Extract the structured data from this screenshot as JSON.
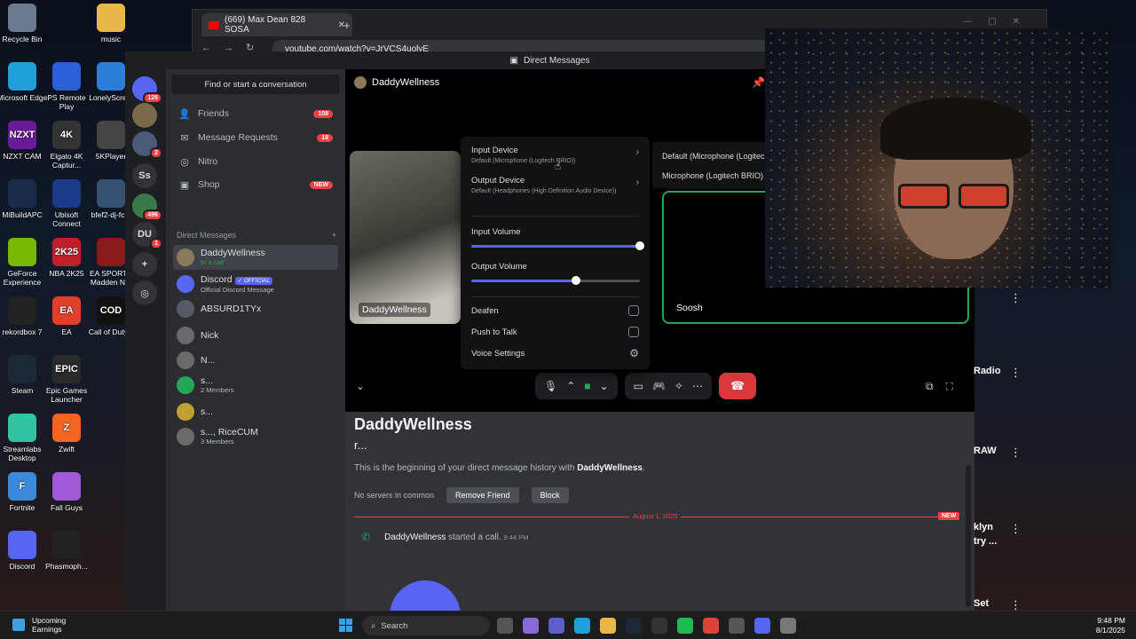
{
  "desktop_icons": [
    {
      "label": "Recycle Bin",
      "icon": "recycle-bin-icon",
      "color": "#6b7a8f"
    },
    {
      "label": "music",
      "icon": "folder-icon",
      "color": "#e8b84a"
    },
    {
      "label": "Microsoft Edge",
      "icon": "edge-icon",
      "color": "#1fa0d8"
    },
    {
      "label": "PS Remote Play",
      "icon": "ps-remote-play-icon",
      "color": "#2b5fd9"
    },
    {
      "label": "LonelyScre...",
      "icon": "monitor-icon",
      "color": "#2b7fd9"
    },
    {
      "label": "NZXT CAM",
      "icon": "nzxt-cam-icon",
      "color": "#6a1b9a",
      "glyph": "NZXT"
    },
    {
      "label": "Elgato 4K Captur...",
      "icon": "elgato-4k-icon",
      "color": "#333333",
      "glyph": "4K"
    },
    {
      "label": "5KPlayer",
      "icon": "5kplayer-icon",
      "color": "#444444"
    },
    {
      "label": "MiBuildAPC",
      "icon": "mibuildapc-icon",
      "color": "#1a2a4a"
    },
    {
      "label": "Ubisoft Connect",
      "icon": "ubisoft-icon",
      "color": "#1a3a8a"
    },
    {
      "label": "bfef2-dj-fc...",
      "icon": "image-file-icon",
      "color": "#355070"
    },
    {
      "label": "GeForce Experience",
      "icon": "geforce-icon",
      "color": "#76b900"
    },
    {
      "label": "NBA 2K25",
      "icon": "nba2k25-icon",
      "color": "#c0202a",
      "glyph": "2K25"
    },
    {
      "label": "EA SPORTS Madden N...",
      "icon": "madden-icon",
      "color": "#8a1a1a"
    },
    {
      "label": "rekordbox 7",
      "icon": "rekordbox-icon",
      "color": "#222222"
    },
    {
      "label": "EA",
      "icon": "ea-icon",
      "color": "#e0402a",
      "glyph": "EA"
    },
    {
      "label": "Call of Duty®",
      "icon": "call-of-duty-icon",
      "color": "#111111",
      "glyph": "COD"
    },
    {
      "label": "Steam",
      "icon": "steam-icon",
      "color": "#1b2838"
    },
    {
      "label": "Epic Games Launcher",
      "icon": "epic-games-icon",
      "color": "#2a2a2a",
      "glyph": "EPIC"
    },
    {
      "label": "Streamlabs Desktop",
      "icon": "streamlabs-icon",
      "color": "#31c3a2"
    },
    {
      "label": "Zwift",
      "icon": "zwift-icon",
      "color": "#f26522",
      "glyph": "Z"
    },
    {
      "label": "Fortnite",
      "icon": "fortnite-icon",
      "color": "#3a8ad9",
      "glyph": "F"
    },
    {
      "label": "Fall Guys",
      "icon": "fall-guys-icon",
      "color": "#a05ad9"
    },
    {
      "label": "Discord",
      "icon": "discord-icon",
      "color": "#5865f2"
    },
    {
      "label": "Phasmoph...",
      "icon": "phasmophobia-icon",
      "color": "#222222"
    }
  ],
  "browser": {
    "tab_title": "(669) Max Dean 828 SOSA",
    "url": "youtube.com/watch?v=JrVCS4uolyE"
  },
  "discord": {
    "window_title": "Direct Messages",
    "servers": [
      {
        "label": "",
        "badge": "126",
        "icon": "discord-home-icon",
        "color": "#5865f2"
      },
      {
        "label": "",
        "badge": "",
        "icon": "server-avatar-icon",
        "color": "#7a6a4a"
      },
      {
        "label": "",
        "badge": "2",
        "icon": "server-avatar-icon",
        "color": "#4a5a7a"
      },
      {
        "label": "Ss",
        "badge": "",
        "icon": "",
        "color": "#313338"
      },
      {
        "label": "",
        "badge": "496",
        "icon": "server-avatar-icon",
        "color": "#3a7a4a"
      },
      {
        "label": "DU",
        "badge": "1",
        "icon": "",
        "color": "#313338"
      },
      {
        "label": "+",
        "badge": "",
        "icon": "add-server-icon",
        "color": "#313338"
      },
      {
        "label": "◎",
        "badge": "",
        "icon": "discover-icon",
        "color": "#313338"
      }
    ],
    "search_placeholder": "Find or start a conversation",
    "nav": [
      {
        "label": "Friends",
        "badge": "108",
        "icon": "friends-icon",
        "glyph": "👤"
      },
      {
        "label": "Message Requests",
        "badge": "18",
        "icon": "message-requests-icon",
        "glyph": "✉"
      },
      {
        "label": "Nitro",
        "badge": "",
        "icon": "nitro-icon",
        "glyph": "◎"
      },
      {
        "label": "Shop",
        "badge": "NEW",
        "icon": "shop-icon",
        "glyph": "▣"
      }
    ],
    "dm_header": "Direct Messages",
    "dms": [
      {
        "name": "DaddyWellness",
        "sub": "In a call",
        "color": "#8a7a5a"
      },
      {
        "name": "Discord",
        "sub": "Official Discord Message",
        "tag": "✓ OFFICIAL",
        "color": "#5865f2"
      },
      {
        "name": "ABSURD1TYx",
        "sub": "",
        "color": "#555a66"
      },
      {
        "name": "Nick",
        "sub": "",
        "color": "#6a6a6a"
      },
      {
        "name": "N...",
        "sub": "",
        "color": "#6a6a6a"
      },
      {
        "name": "s...",
        "sub": "2 Members",
        "color": "#23a55a"
      },
      {
        "name": "s...",
        "sub": "",
        "color": "#c0a030"
      },
      {
        "name": "s..., RiceCUM",
        "sub": "3 Members",
        "color": "#6a6a6a"
      }
    ],
    "call": {
      "header_name": "DaddyWellness",
      "tiles": [
        {
          "label": "DaddyWellness"
        },
        {
          "label": "Soosh"
        }
      ]
    },
    "audio_popup": {
      "input_device_title": "Input Device",
      "input_device_value": "Default (Microphone (Logitech BRIO))",
      "output_device_title": "Output Device",
      "output_device_value": "Default (Headphones (High Definition Audio Device))",
      "input_volume_label": "Input Volume",
      "input_volume": 1.0,
      "output_volume_label": "Output Volume",
      "output_volume": 0.62,
      "deafen_label": "Deafen",
      "push_to_talk_label": "Push to Talk",
      "voice_settings_label": "Voice Settings"
    },
    "input_submenu": [
      "Default (Microphone (Logitech BRIO))",
      "Microphone (Logitech BRIO)"
    ],
    "chat": {
      "title": "DaddyWellness",
      "handle": "r...",
      "beginning_prefix": "This is the beginning of your direct message history with ",
      "beginning_name": "DaddyWellness",
      "beginning_suffix": ".",
      "no_servers": "No servers in common",
      "remove_friend": "Remove Friend",
      "block": "Block",
      "date_divider": "August 1, 2025",
      "new_tag": "NEW",
      "call_author": "DaddyWellness",
      "call_text": "started a call.",
      "call_time": "9:44 PM"
    }
  },
  "youtube_peek": [
    "Radio",
    "RAW",
    "klyn",
    "try ...",
    "Set"
  ],
  "taskbar": {
    "weather_title": "Upcoming",
    "weather_sub": "Earnings",
    "search_label": "Search",
    "time": "9:48 PM",
    "date": "8/1/2025",
    "apps": [
      {
        "icon": "task-view-icon",
        "color": "#555555"
      },
      {
        "icon": "copilot-icon",
        "color": "#8a6ad9"
      },
      {
        "icon": "teams-icon",
        "color": "#5b5fc7"
      },
      {
        "icon": "edge-icon",
        "color": "#1fa0d8"
      },
      {
        "icon": "file-explorer-icon",
        "color": "#e8b84a"
      },
      {
        "icon": "steam-icon",
        "color": "#1b2838"
      },
      {
        "icon": "github-icon",
        "color": "#333333"
      },
      {
        "icon": "spotify-icon",
        "color": "#1db954"
      },
      {
        "icon": "chrome-icon",
        "color": "#db4437"
      },
      {
        "icon": "inbox-icon",
        "color": "#555555"
      },
      {
        "icon": "discord-icon",
        "color": "#5865f2"
      },
      {
        "icon": "settings-icon",
        "color": "#777777"
      }
    ]
  }
}
